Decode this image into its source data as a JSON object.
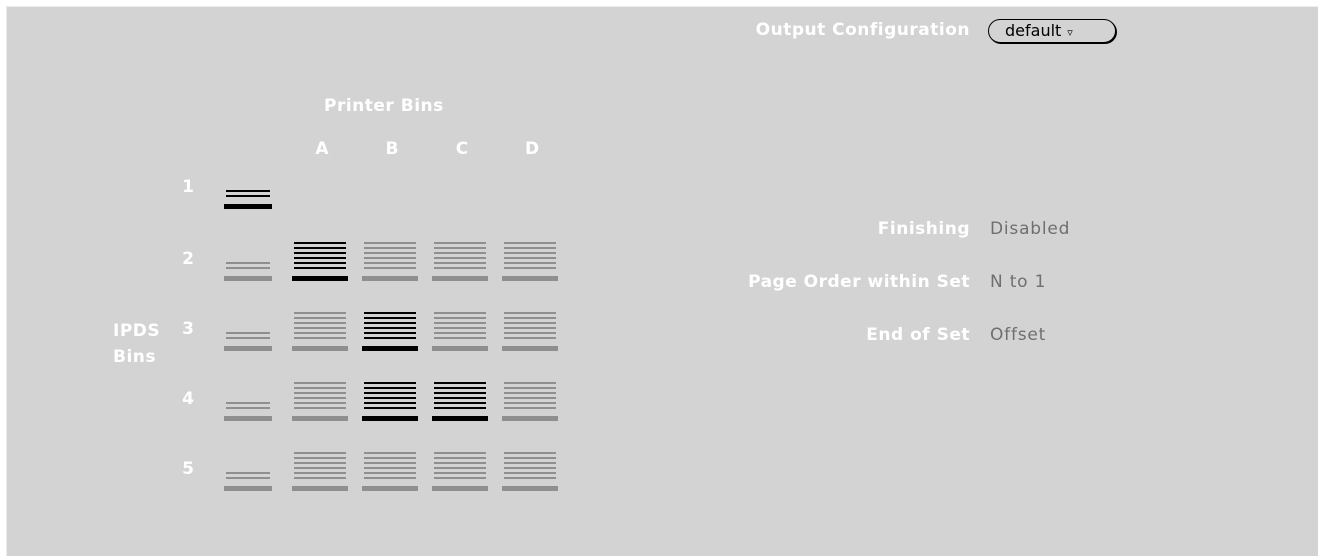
{
  "output_config": {
    "label": "Output Configuration",
    "value": "default",
    "arrow": "▿"
  },
  "printer_bins": {
    "title": "Printer Bins",
    "columns": [
      "A",
      "B",
      "C",
      "D"
    ]
  },
  "ipds_bins": {
    "title_line1": "IPDS",
    "title_line2": "Bins",
    "rows": [
      "1",
      "2",
      "3",
      "4",
      "5"
    ]
  },
  "mapping": {
    "selected": [
      [
        1,
        0
      ],
      [
        2,
        1
      ],
      [
        3,
        1
      ],
      [
        3,
        2
      ]
    ],
    "active_color": "#000000",
    "inactive_color": "#8f8f8f"
  },
  "settings": [
    {
      "label": "Finishing",
      "value": "Disabled"
    },
    {
      "label": "Page Order within Set",
      "value": "N to 1"
    },
    {
      "label": "End of Set",
      "value": "Offset"
    }
  ]
}
